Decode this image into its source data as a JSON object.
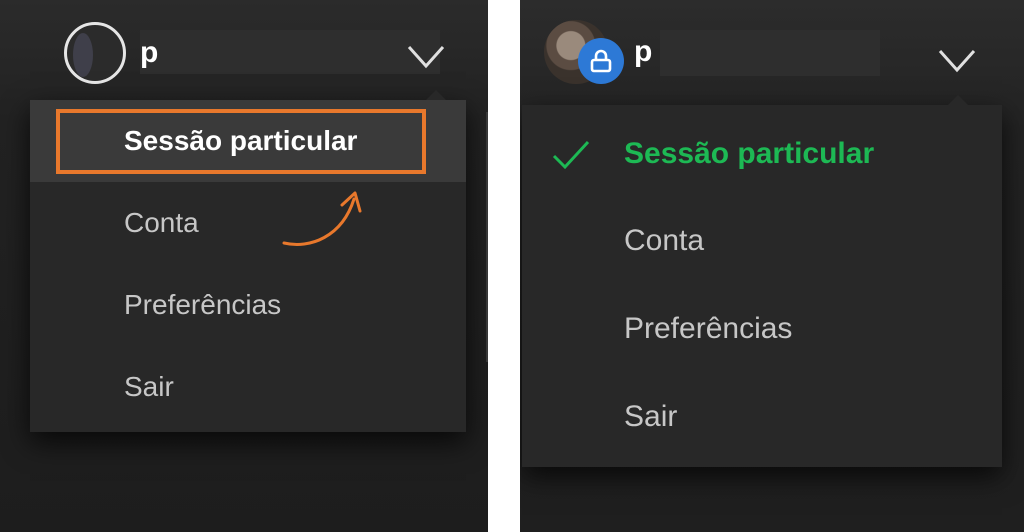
{
  "colors": {
    "accent_green": "#1db954",
    "highlight_orange": "#e8782c",
    "lock_badge_blue": "#2d79d6"
  },
  "left_panel": {
    "username": "p",
    "avatar_icon": "user-avatar",
    "chevron_icon": "chevron-down-icon",
    "menu": {
      "items": [
        {
          "label": "Sessão particular",
          "state": "hover-highlighted"
        },
        {
          "label": "Conta"
        },
        {
          "label": "Preferências"
        },
        {
          "label": "Sair"
        }
      ]
    },
    "annotation": {
      "box_color": "#e8782c",
      "arrow_icon": "curved-arrow-icon"
    }
  },
  "right_panel": {
    "username": "p",
    "avatar_icon": "user-photo-avatar",
    "lock_icon": "lock-icon",
    "chevron_icon": "chevron-down-icon",
    "menu": {
      "items": [
        {
          "label": "Sessão particular",
          "state": "checked",
          "icon": "checkmark-icon"
        },
        {
          "label": "Conta"
        },
        {
          "label": "Preferências"
        },
        {
          "label": "Sair"
        }
      ]
    }
  }
}
